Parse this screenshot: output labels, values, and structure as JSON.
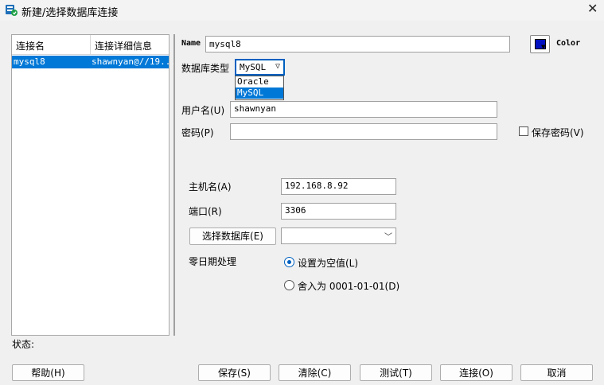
{
  "window": {
    "title": "新建/选择数据库连接",
    "close_glyph": "✕"
  },
  "connections": {
    "col_name": "连接名",
    "col_detail": "连接详细信息",
    "rows": [
      {
        "name": "mysql8",
        "detail": "shawnyan@//19..."
      }
    ]
  },
  "form": {
    "name_label": "Name",
    "name_value": "mysql8",
    "color_label": "Color",
    "color_value": "#0010c0",
    "db_type_label": "数据库类型",
    "db_type_value": "MySQL",
    "db_type_options": [
      "Oracle",
      "MySQL"
    ],
    "user_label": "用户名(U)",
    "user_value": "shawnyan",
    "password_label": "密码(P)",
    "password_value": "",
    "save_password_label": "保存密码(V)",
    "host_label": "主机名(A)",
    "host_value": "192.168.8.92",
    "port_label": "端口(R)",
    "port_value": "3306",
    "choose_db_button": "选择数据库(E)",
    "choose_db_value": "",
    "zero_date_label": "零日期处理",
    "zero_date_opt1": "设置为空值(L)",
    "zero_date_opt2": "舍入为 0001-01-01(D)",
    "zero_date_selected": "设置为空值(L)"
  },
  "status_label": "状态:",
  "buttons": {
    "help": "帮助(H)",
    "save": "保存(S)",
    "clear": "清除(C)",
    "test": "测试(T)",
    "connect": "连接(O)",
    "cancel": "取消"
  },
  "colors": {
    "selection": "#0078d7",
    "accent": "#0060c0"
  },
  "icons": {
    "app": "database-connect-icon",
    "close": "close-icon",
    "chevron": "chevron-down-icon"
  }
}
